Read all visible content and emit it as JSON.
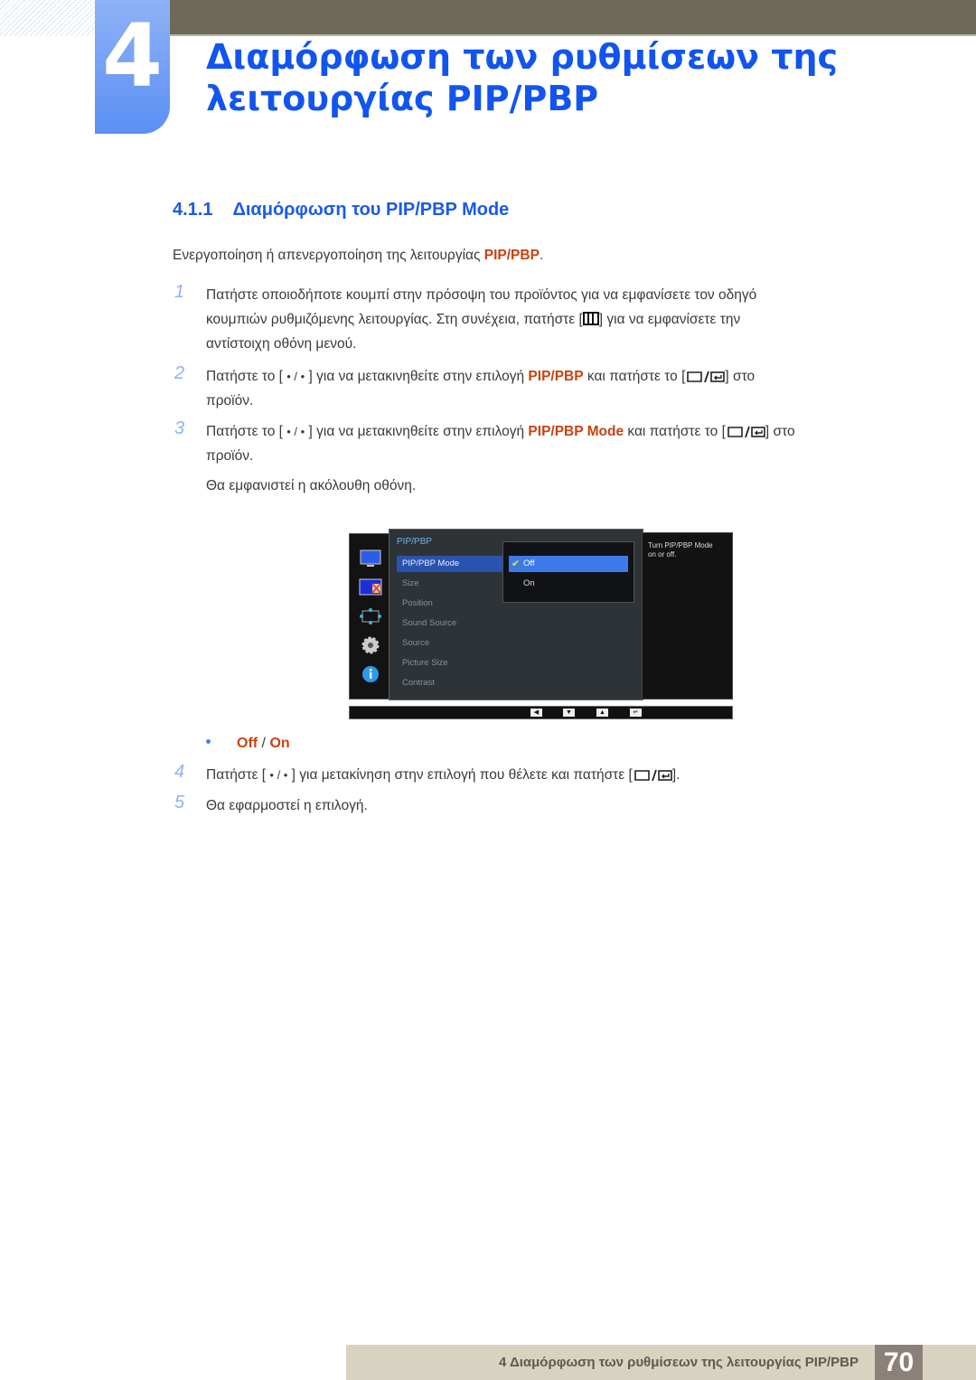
{
  "chapter": {
    "number": "4",
    "title_line1": "Διαμόρφωση των ρυθμίσεων της",
    "title_line2": "λειτουργίας PIP/PBP"
  },
  "section": {
    "number": "4.1.1",
    "title": "Διαμόρφωση του PIP/PBP Mode"
  },
  "intro": {
    "text": "Ενεργοποίηση ή απενεργοποίηση της λειτουργίας ",
    "highlight": "PIP/PBP",
    "end": "."
  },
  "steps": [
    {
      "num": "1",
      "line1": "Πατήστε οποιοδήποτε κουμπί στην πρόσοψη του προϊόντος για να εμφανίσετε τον οδηγό",
      "line2a": "κουμπιών ρυθμιζόμενης λειτουργίας. Στη συνέχεια, πατήστε [",
      "line2b": "] για να εμφανίσετε την",
      "line3": "αντίστοιχη οθόνη μενού."
    },
    {
      "num": "2",
      "a": "Πατήστε το [ ",
      "b": " ] για να μετακινηθείτε στην επιλογή ",
      "highlight": "PIP/PBP",
      "c": " και πατήστε το [",
      "d": "] στο",
      "line2": "προϊόν."
    },
    {
      "num": "3",
      "a": "Πατήστε το [ ",
      "b": " ] για να μετακινηθείτε στην επιλογή ",
      "highlight": "PIP/PBP Mode",
      "c": " και πατήστε το [",
      "d": "] στο",
      "line2": "προϊόν.",
      "note": "Θα εμφανιστεί η ακόλουθη οθόνη."
    },
    {
      "num": "4",
      "a": "Πατήστε [ ",
      "b": " ] για μετακίνηση στην επιλογή που θέλετε και πατήστε [",
      "c": "]."
    },
    {
      "num": "5",
      "text": "Θα εφαρμοστεί η επιλογή."
    }
  ],
  "dot_slash": "• / •",
  "options_bullet": {
    "off": "Off",
    "sep": " / ",
    "on": "On"
  },
  "osd": {
    "menu_title": "PIP/PBP",
    "items": [
      "PIP/PBP Mode",
      "Size",
      "Position",
      "Sound Source",
      "Source",
      "Picture Size",
      "Contrast"
    ],
    "selected_item": "PIP/PBP Mode",
    "options": [
      "Off",
      "On"
    ],
    "selected_option": "Off",
    "help_line1": "Turn PIP/PBP Mode",
    "help_line2": "on or off.",
    "nav_buttons": [
      "◀",
      "▼",
      "▲",
      "↵"
    ],
    "sidebar_icons": [
      "picture-icon",
      "pip-icon",
      "position-icon",
      "settings-icon",
      "info-icon"
    ]
  },
  "footer": {
    "text": "4 Διαμόρφωση των ρυθμίσεων της λειτουργίας PIP/PBP",
    "page": "70"
  },
  "colors": {
    "heading_blue": "#1155ee",
    "highlight_orange": "#c8420f",
    "step_number": "#8fb4f2",
    "osd_selection": "#3d7ae8"
  }
}
